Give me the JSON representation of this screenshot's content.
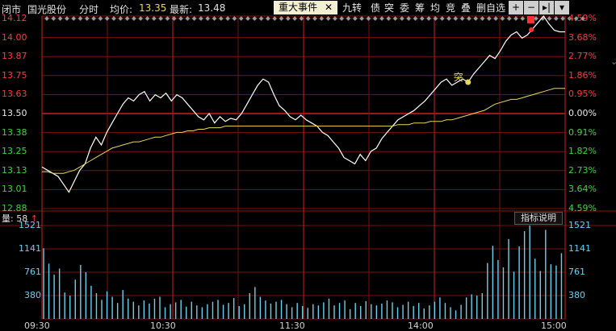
{
  "header": {
    "status": "闭市",
    "stock_name": "国光股份",
    "mode": "分时",
    "avg_label": "均价:",
    "avg_value": "13.35",
    "last_label": "最新:",
    "last_value": "13.48"
  },
  "toolbar": {
    "event_label": "重大事件",
    "event_close": "✕",
    "items": [
      "九转",
      "债",
      "突",
      "委",
      "筹",
      "均",
      "竞",
      "叠",
      "删自选"
    ],
    "controls": [
      "+",
      "−",
      "▸|",
      "▾"
    ]
  },
  "price_axis": {
    "left": [
      "14.12",
      "14.00",
      "13.87",
      "13.75",
      "13.63",
      "13.50",
      "13.38",
      "13.25",
      "13.13",
      "13.01",
      "12.88"
    ],
    "right": [
      "4.59%",
      "3.68%",
      "2.77%",
      "1.86%",
      "0.95%",
      "0.00%",
      "0.91%",
      "1.82%",
      "2.73%",
      "3.64%",
      "4.59%"
    ],
    "colors": {
      "up": "#ff3b3b",
      "flat": "#e8e8e8",
      "down": "#3cd83c"
    }
  },
  "volume": {
    "header_label": "量:",
    "header_value": "58",
    "indicator_button": "指标说明",
    "axis": [
      "1521",
      "1141",
      "761",
      "380"
    ]
  },
  "time_axis": [
    "09:30",
    "10:30",
    "11:30",
    "14:00",
    "15:00"
  ],
  "marker": {
    "label": "突"
  },
  "chart_data": {
    "type": "line",
    "title": "",
    "ylim": [
      12.88,
      14.12
    ],
    "series": [
      {
        "name": "price",
        "color": "#ffffff",
        "values": [
          13.16,
          13.14,
          13.12,
          13.1,
          13.05,
          13.0,
          13.07,
          13.14,
          13.18,
          13.28,
          13.35,
          13.3,
          13.38,
          13.44,
          13.5,
          13.56,
          13.6,
          13.58,
          13.62,
          13.64,
          13.58,
          13.62,
          13.6,
          13.63,
          13.58,
          13.62,
          13.6,
          13.56,
          13.52,
          13.48,
          13.46,
          13.5,
          13.44,
          13.48,
          13.45,
          13.47,
          13.46,
          13.5,
          13.56,
          13.62,
          13.68,
          13.72,
          13.7,
          13.62,
          13.55,
          13.52,
          13.48,
          13.46,
          13.49,
          13.46,
          13.44,
          13.42,
          13.38,
          13.36,
          13.32,
          13.28,
          13.22,
          13.2,
          13.18,
          13.24,
          13.2,
          13.26,
          13.28,
          13.34,
          13.38,
          13.42,
          13.46,
          13.48,
          13.5,
          13.52,
          13.55,
          13.58,
          13.62,
          13.66,
          13.7,
          13.72,
          13.68,
          13.7,
          13.72,
          13.7,
          13.75,
          13.79,
          13.83,
          13.87,
          13.85,
          13.9,
          13.96,
          14.0,
          14.02,
          13.98,
          14.0,
          14.04,
          14.08,
          14.12,
          14.07,
          14.03,
          14.02,
          14.02
        ]
      },
      {
        "name": "avg",
        "color": "#e8d85a",
        "values": [
          13.13,
          13.13,
          13.12,
          13.12,
          13.12,
          13.13,
          13.14,
          13.16,
          13.18,
          13.2,
          13.22,
          13.24,
          13.26,
          13.28,
          13.29,
          13.3,
          13.31,
          13.32,
          13.32,
          13.33,
          13.34,
          13.35,
          13.35,
          13.36,
          13.37,
          13.38,
          13.38,
          13.39,
          13.39,
          13.4,
          13.4,
          13.41,
          13.41,
          13.41,
          13.42,
          13.42,
          13.42,
          13.42,
          13.42,
          13.42,
          13.42,
          13.42,
          13.42,
          13.42,
          13.42,
          13.42,
          13.42,
          13.42,
          13.42,
          13.42,
          13.42,
          13.42,
          13.42,
          13.42,
          13.42,
          13.42,
          13.42,
          13.42,
          13.42,
          13.42,
          13.42,
          13.42,
          13.42,
          13.42,
          13.42,
          13.42,
          13.43,
          13.43,
          13.43,
          13.44,
          13.44,
          13.44,
          13.45,
          13.45,
          13.45,
          13.46,
          13.46,
          13.47,
          13.48,
          13.49,
          13.5,
          13.51,
          13.52,
          13.54,
          13.56,
          13.57,
          13.58,
          13.59,
          13.59,
          13.6,
          13.61,
          13.62,
          13.63,
          13.64,
          13.65,
          13.66,
          13.66,
          13.66
        ]
      }
    ],
    "volume_bars": [
      1150,
      900,
      720,
      820,
      430,
      380,
      640,
      880,
      760,
      540,
      420,
      310,
      450,
      360,
      260,
      470,
      330,
      280,
      220,
      300,
      250,
      330,
      360,
      190,
      240,
      270,
      310,
      200,
      280,
      220,
      190,
      240,
      280,
      310,
      230,
      260,
      340,
      210,
      240,
      420,
      520,
      360,
      300,
      250,
      280,
      310,
      240,
      190,
      260,
      210,
      180,
      240,
      220,
      270,
      330,
      220,
      260,
      300,
      160,
      260,
      210,
      290,
      240,
      220,
      250,
      300,
      270,
      190,
      230,
      280,
      210,
      260,
      170,
      220,
      280,
      350,
      260,
      190,
      140,
      230,
      350,
      400,
      380,
      420,
      910,
      1190,
      960,
      840,
      1300,
      770,
      1180,
      1430,
      1520,
      980,
      780,
      1450,
      890,
      870,
      1070
    ]
  }
}
